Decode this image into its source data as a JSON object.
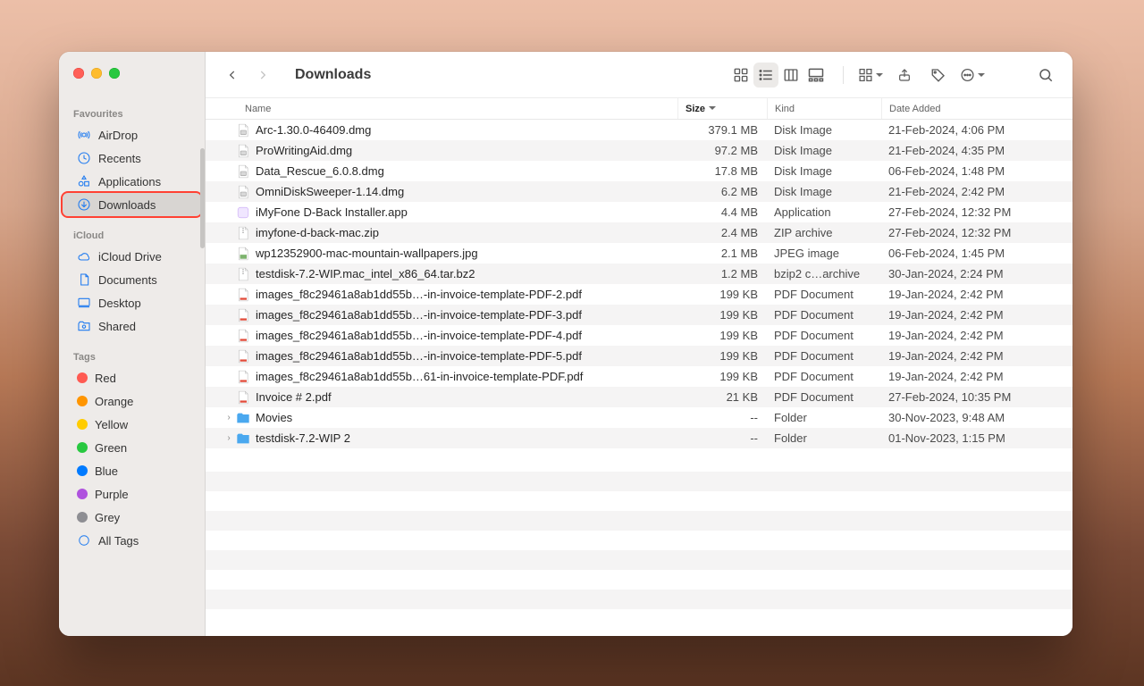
{
  "window": {
    "title": "Downloads"
  },
  "sidebar": {
    "sections": [
      {
        "heading": "Favourites",
        "items": [
          {
            "icon": "airdrop",
            "label": "AirDrop"
          },
          {
            "icon": "recents",
            "label": "Recents"
          },
          {
            "icon": "apps",
            "label": "Applications"
          },
          {
            "icon": "downloads",
            "label": "Downloads",
            "selected": true,
            "highlighted": true
          }
        ]
      },
      {
        "heading": "iCloud",
        "items": [
          {
            "icon": "cloud",
            "label": "iCloud Drive"
          },
          {
            "icon": "doc",
            "label": "Documents"
          },
          {
            "icon": "desk",
            "label": "Desktop"
          },
          {
            "icon": "share",
            "label": "Shared"
          }
        ]
      },
      {
        "heading": "Tags",
        "items": [
          {
            "color": "#ff5a52",
            "label": "Red"
          },
          {
            "color": "#ff9500",
            "label": "Orange"
          },
          {
            "color": "#ffcc00",
            "label": "Yellow"
          },
          {
            "color": "#28c840",
            "label": "Green"
          },
          {
            "color": "#007aff",
            "label": "Blue"
          },
          {
            "color": "#af52de",
            "label": "Purple"
          },
          {
            "color": "#8e8e93",
            "label": "Grey"
          },
          {
            "icon": "alltags",
            "label": "All Tags"
          }
        ]
      }
    ]
  },
  "columns": {
    "name": "Name",
    "size": "Size",
    "kind": "Kind",
    "date": "Date Added",
    "sort_col": "size",
    "sort_dir": "desc"
  },
  "files": [
    {
      "icon": "dmg",
      "name": "Arc-1.30.0-46409.dmg",
      "size": "379.1 MB",
      "kind": "Disk Image",
      "date": "21-Feb-2024, 4:06 PM"
    },
    {
      "icon": "dmg",
      "name": "ProWritingAid.dmg",
      "size": "97.2 MB",
      "kind": "Disk Image",
      "date": "21-Feb-2024, 4:35 PM"
    },
    {
      "icon": "dmg",
      "name": "Data_Rescue_6.0.8.dmg",
      "size": "17.8 MB",
      "kind": "Disk Image",
      "date": "06-Feb-2024, 1:48 PM"
    },
    {
      "icon": "dmg",
      "name": "OmniDiskSweeper-1.14.dmg",
      "size": "6.2 MB",
      "kind": "Disk Image",
      "date": "21-Feb-2024, 2:42 PM"
    },
    {
      "icon": "app",
      "name": "iMyFone D-Back Installer.app",
      "size": "4.4 MB",
      "kind": "Application",
      "date": "27-Feb-2024, 12:32 PM"
    },
    {
      "icon": "zip",
      "name": "imyfone-d-back-mac.zip",
      "size": "2.4 MB",
      "kind": "ZIP archive",
      "date": "27-Feb-2024, 12:32 PM"
    },
    {
      "icon": "jpg",
      "name": "wp12352900-mac-mountain-wallpapers.jpg",
      "size": "2.1 MB",
      "kind": "JPEG image",
      "date": "06-Feb-2024, 1:45 PM"
    },
    {
      "icon": "bz2",
      "name": "testdisk-7.2-WIP.mac_intel_x86_64.tar.bz2",
      "size": "1.2 MB",
      "kind": "bzip2 c…archive",
      "date": "30-Jan-2024, 2:24 PM"
    },
    {
      "icon": "pdf",
      "name": "images_f8c29461a8ab1dd55b…-in-invoice-template-PDF-2.pdf",
      "size": "199 KB",
      "kind": "PDF Document",
      "date": "19-Jan-2024, 2:42 PM"
    },
    {
      "icon": "pdf",
      "name": "images_f8c29461a8ab1dd55b…-in-invoice-template-PDF-3.pdf",
      "size": "199 KB",
      "kind": "PDF Document",
      "date": "19-Jan-2024, 2:42 PM"
    },
    {
      "icon": "pdf",
      "name": "images_f8c29461a8ab1dd55b…-in-invoice-template-PDF-4.pdf",
      "size": "199 KB",
      "kind": "PDF Document",
      "date": "19-Jan-2024, 2:42 PM"
    },
    {
      "icon": "pdf",
      "name": "images_f8c29461a8ab1dd55b…-in-invoice-template-PDF-5.pdf",
      "size": "199 KB",
      "kind": "PDF Document",
      "date": "19-Jan-2024, 2:42 PM"
    },
    {
      "icon": "pdf",
      "name": "images_f8c29461a8ab1dd55b…61-in-invoice-template-PDF.pdf",
      "size": "199 KB",
      "kind": "PDF Document",
      "date": "19-Jan-2024, 2:42 PM"
    },
    {
      "icon": "pdf",
      "name": "Invoice # 2.pdf",
      "size": "21 KB",
      "kind": "PDF Document",
      "date": "27-Feb-2024, 10:35 PM"
    },
    {
      "icon": "folder",
      "name": "Movies",
      "expandable": true,
      "size": "--",
      "kind": "Folder",
      "date": "30-Nov-2023, 9:48 AM"
    },
    {
      "icon": "folder",
      "name": "testdisk-7.2-WIP 2",
      "expandable": true,
      "size": "--",
      "kind": "Folder",
      "date": "01-Nov-2023, 1:15 PM"
    }
  ],
  "colors": {
    "accent": "#1e7af0"
  }
}
